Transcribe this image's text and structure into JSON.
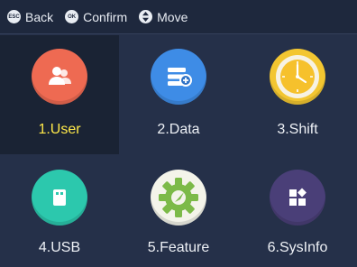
{
  "topbar": {
    "back_key": "ESC",
    "back_label": "Back",
    "confirm_key": "OK",
    "confirm_label": "Confirm",
    "move_label": "Move"
  },
  "menu": {
    "selected_index": 0,
    "items": [
      {
        "label": "1.User",
        "icon": "user-icon",
        "color": "#ee6a52"
      },
      {
        "label": "2.Data",
        "icon": "database-icon",
        "color": "#3e8ce6"
      },
      {
        "label": "3.Shift",
        "icon": "clock-icon",
        "color": "#f3c631"
      },
      {
        "label": "4.USB",
        "icon": "usb-icon",
        "color": "#2cc8ad"
      },
      {
        "label": "5.Feature",
        "icon": "gear-icon",
        "color": "#78b84a"
      },
      {
        "label": "6.SysInfo",
        "icon": "system-info-icon",
        "color": "#4a3f78"
      }
    ]
  }
}
